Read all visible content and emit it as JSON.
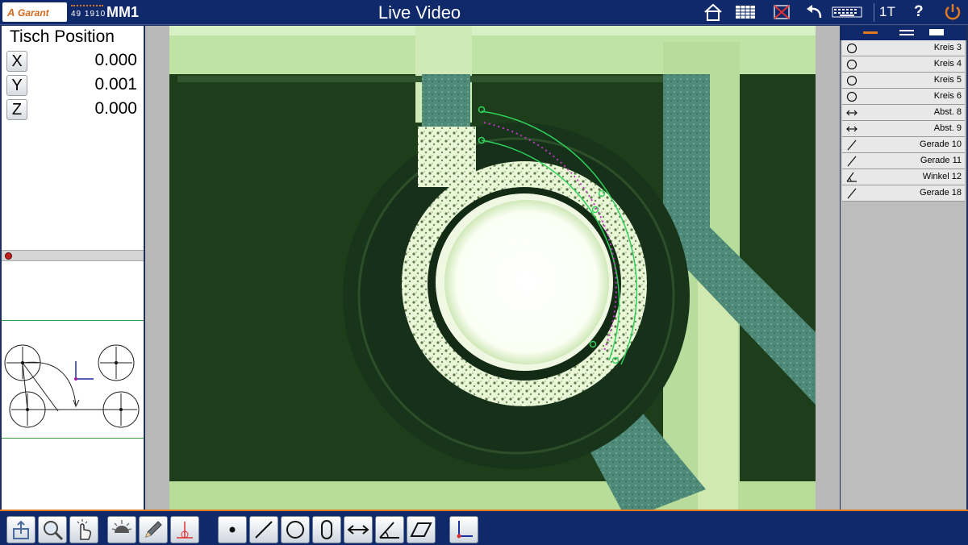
{
  "header": {
    "brand": "Garant",
    "model_number": "49 1910",
    "model_name": "MM1",
    "view_title": "Live Video",
    "mode_label": "1T",
    "help_label": "?"
  },
  "position": {
    "title": "Tisch Position",
    "axes": [
      {
        "axis": "X",
        "value": "0.000"
      },
      {
        "axis": "Y",
        "value": "0.001"
      },
      {
        "axis": "Z",
        "value": "0.000"
      }
    ]
  },
  "features": [
    {
      "label": "Kreis 3",
      "icon": "circle-icon"
    },
    {
      "label": "Kreis 4",
      "icon": "circle-icon"
    },
    {
      "label": "Kreis 5",
      "icon": "circle-icon"
    },
    {
      "label": "Kreis 6",
      "icon": "circle-icon"
    },
    {
      "label": "Abst. 8",
      "icon": "distance-icon"
    },
    {
      "label": "Abst. 9",
      "icon": "distance-icon"
    },
    {
      "label": "Gerade 10",
      "icon": "line-icon"
    },
    {
      "label": "Gerade 11",
      "icon": "line-icon"
    },
    {
      "label": "Winkel 12",
      "icon": "angle-icon"
    },
    {
      "label": "Gerade 18",
      "icon": "line-icon"
    }
  ],
  "colors": {
    "bar_blue": "#10296b",
    "accent_orange": "#e07a1f",
    "fit_green": "#2fd15a",
    "probe_magenta": "#c436c9"
  }
}
